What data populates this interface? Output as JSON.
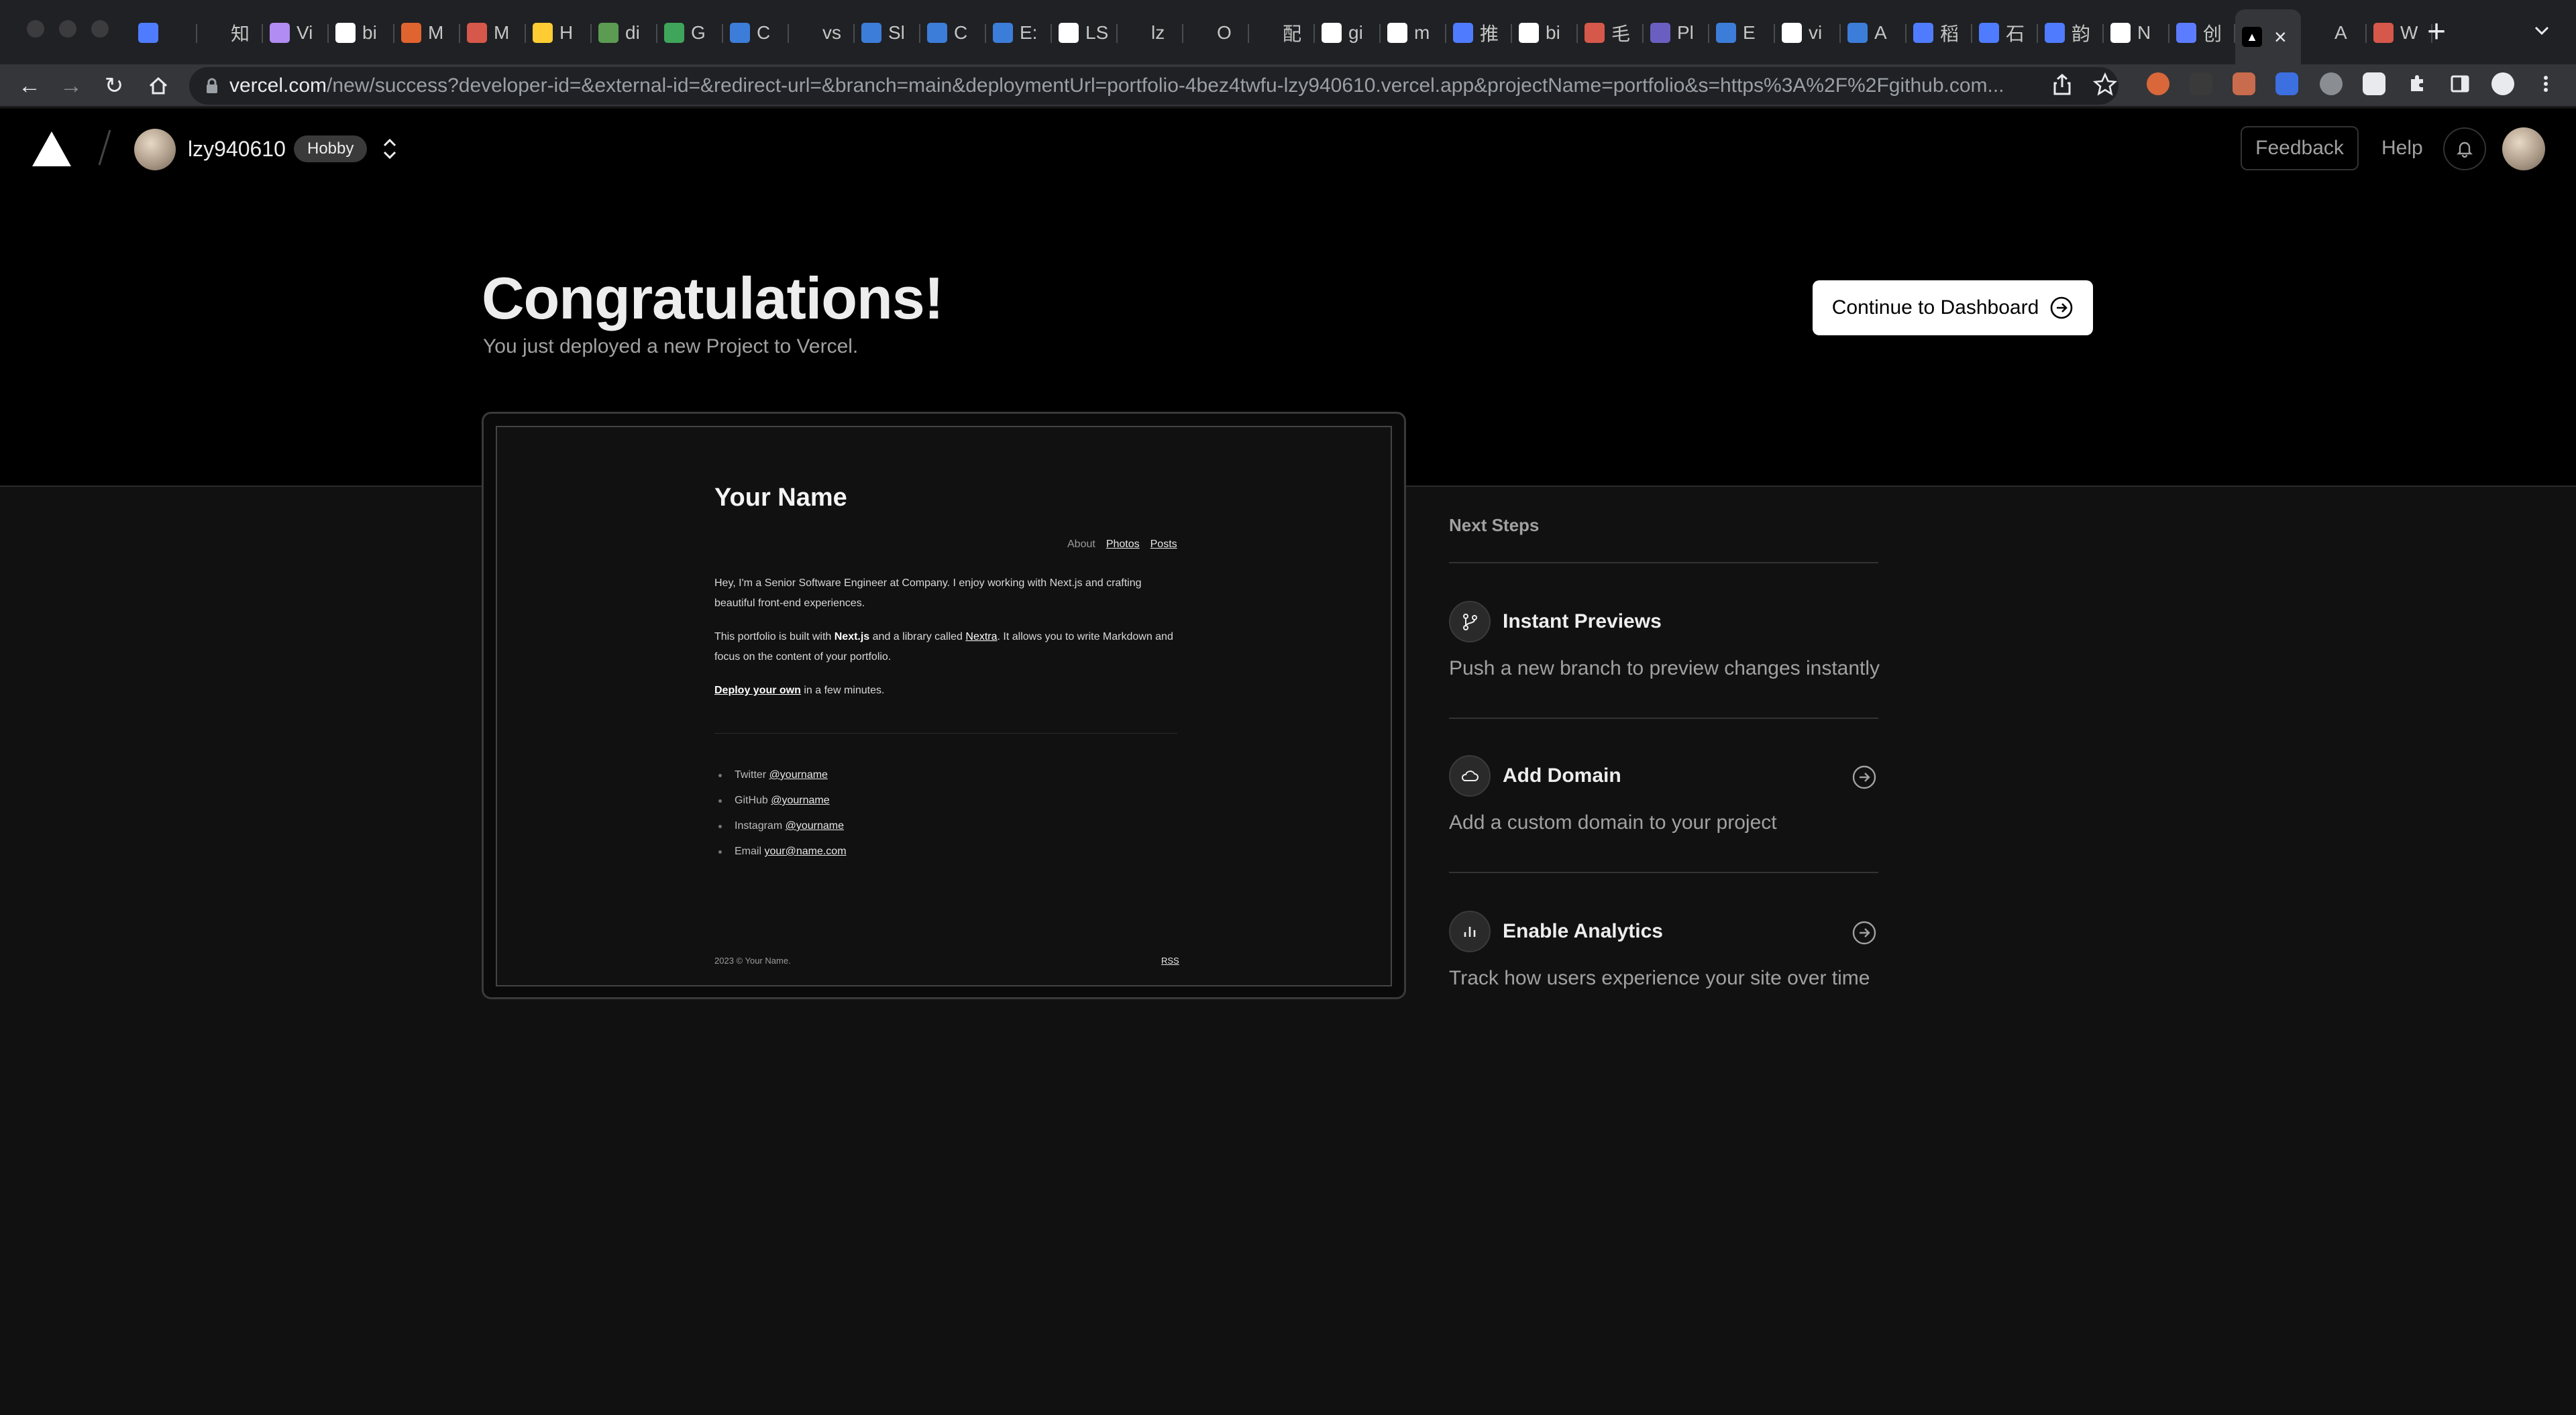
{
  "browser": {
    "tabs": [
      {
        "title": "",
        "color": "#4f7cff"
      },
      {
        "title": "知",
        "color": "#202124"
      },
      {
        "title": "Vi",
        "color": "#b18cf2"
      },
      {
        "title": "bi",
        "color": "#ffffff"
      },
      {
        "title": "M",
        "color": "#e0642f"
      },
      {
        "title": "M",
        "color": "#d5584a"
      },
      {
        "title": "H",
        "color": "#ffcc33"
      },
      {
        "title": "di",
        "color": "#5b9b52"
      },
      {
        "title": "G",
        "color": "#3ea55a"
      },
      {
        "title": "C",
        "color": "#3c7dd9"
      },
      {
        "title": "vs",
        "color": "#202124"
      },
      {
        "title": "Sl",
        "color": "#3c7dd9"
      },
      {
        "title": "C",
        "color": "#3c7dd9"
      },
      {
        "title": "E:",
        "color": "#3c7dd9"
      },
      {
        "title": "LS",
        "color": "#ffffff"
      },
      {
        "title": "lz",
        "color": "#202124"
      },
      {
        "title": "O",
        "color": "#202124"
      },
      {
        "title": "配",
        "color": "#202124"
      },
      {
        "title": "gi",
        "color": "#ffffff"
      },
      {
        "title": "m",
        "color": "#ffffff"
      },
      {
        "title": "推",
        "color": "#4f7cff"
      },
      {
        "title": "bi",
        "color": "#ffffff"
      },
      {
        "title": "毛",
        "color": "#d5584a"
      },
      {
        "title": "Pl",
        "color": "#6a5fc1"
      },
      {
        "title": "E",
        "color": "#3c7dd9"
      },
      {
        "title": "vi",
        "color": "#ffffff"
      },
      {
        "title": "A",
        "color": "#3c7dd9"
      },
      {
        "title": "稻",
        "color": "#4f7cff"
      },
      {
        "title": "石",
        "color": "#4f7cff"
      },
      {
        "title": "韵",
        "color": "#4f7cff"
      },
      {
        "title": "N",
        "color": "#ffffff"
      },
      {
        "title": "创",
        "color": "#5c7cff"
      },
      {
        "title": "",
        "color": "#000000"
      },
      {
        "title": "A",
        "color": "#202124"
      },
      {
        "title": "W",
        "color": "#d5584a"
      }
    ],
    "url_host": "vercel.com",
    "url_rest": "/new/success?developer-id=&external-id=&redirect-url=&branch=main&deploymentUrl=portfolio-4bez4twfu-lzy940610.vercel.app&projectName=portfolio&s=https%3A%2F%2Fgithub.com..."
  },
  "header": {
    "team_name": "lzy940610",
    "plan_badge": "Hobby",
    "feedback_label": "Feedback",
    "help_label": "Help"
  },
  "hero": {
    "title": "Congratulations!",
    "subtitle": "You just deployed a new Project to Vercel.",
    "continue_label": "Continue to Dashboard"
  },
  "preview": {
    "site_title": "Your Name",
    "nav": [
      "About",
      "Photos",
      "Posts"
    ],
    "para1": "Hey, I'm a Senior Software Engineer at Company. I enjoy working with Next.js and crafting beautiful front-end experiences.",
    "para2_a": "This portfolio is built with ",
    "para2_b": "Next.js",
    "para2_c": " and a library called ",
    "para2_d": "Nextra",
    "para2_e": ". It allows you to write Markdown and focus on the content of your portfolio.",
    "deploy_link": "Deploy your own",
    "deploy_rest": " in a few minutes.",
    "socials": [
      {
        "label": "Twitter ",
        "handle": "@yourname"
      },
      {
        "label": "GitHub ",
        "handle": "@yourname"
      },
      {
        "label": "Instagram ",
        "handle": "@yourname"
      },
      {
        "label": "Email ",
        "handle": "your@name.com"
      }
    ],
    "footer": "2023 © Your Name.",
    "rss": "RSS"
  },
  "next_steps": {
    "title": "Next Steps",
    "items": [
      {
        "heading": "Instant Previews",
        "description": "Push a new branch to preview changes instantly",
        "icon": "git-branch-icon"
      },
      {
        "heading": "Add Domain",
        "description": "Add a custom domain to your project",
        "icon": "cloud-icon"
      },
      {
        "heading": "Enable Analytics",
        "description": "Track how users experience your site over time",
        "icon": "bar-chart-icon"
      }
    ]
  }
}
